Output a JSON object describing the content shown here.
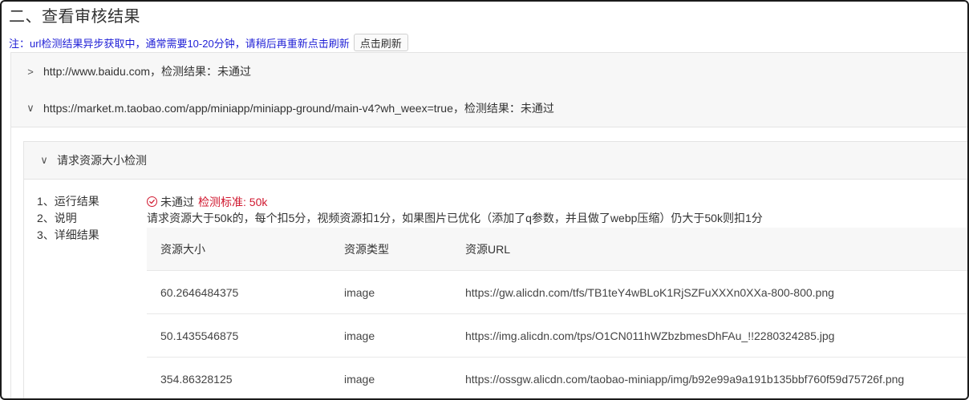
{
  "section": {
    "title": "二、查看审核结果"
  },
  "notice": {
    "text": "注：url检测结果异步获取中，通常需要10-20分钟，请稍后再重新点击刷新",
    "refresh_label": "点击刷新"
  },
  "urls": [
    {
      "chevron": ">",
      "text": "http://www.baidu.com，检测结果：未通过",
      "expanded": false
    },
    {
      "chevron": "∨",
      "text": "https://market.m.taobao.com/app/miniapp/miniapp-ground/main-v4?wh_weex=true，检测结果：未通过",
      "expanded": true
    }
  ],
  "check": {
    "chevron": "∨",
    "title": "请求资源大小检测",
    "steps": [
      "1、运行结果",
      "2、说明",
      "3、详细结果"
    ],
    "result": {
      "status": "未通过",
      "criteria": "检测标准: 50k"
    },
    "description": "请求资源大于50k的，每个扣5分，视频资源扣1分，如果图片已优化（添加了q参数，并且做了webp压缩）仍大于50k则扣1分",
    "table": {
      "headers": [
        "资源大小",
        "资源类型",
        "资源URL"
      ],
      "rows": [
        [
          "60.2646484375",
          "image",
          "https://gw.alicdn.com/tfs/TB1teY4wBLoK1RjSZFuXXXn0XXa-800-800.png"
        ],
        [
          "50.1435546875",
          "image",
          "https://img.alicdn.com/tps/O1CN011hWZbzbmesDhFAu_!!2280324285.jpg"
        ],
        [
          "354.86328125",
          "image",
          "https://ossgw.alicdn.com/taobao-miniapp/img/b92e99a9a191b135bbf760f59d75726f.png"
        ]
      ]
    }
  },
  "colors": {
    "notice": "#1f1fd6",
    "fail": "#d0182f",
    "panel_bg": "#f7f7f7",
    "border": "#e4e4e4"
  },
  "icons": {
    "fail": "circle-check-icon",
    "collapsed": "chevron-right-icon",
    "expanded": "chevron-down-icon"
  }
}
